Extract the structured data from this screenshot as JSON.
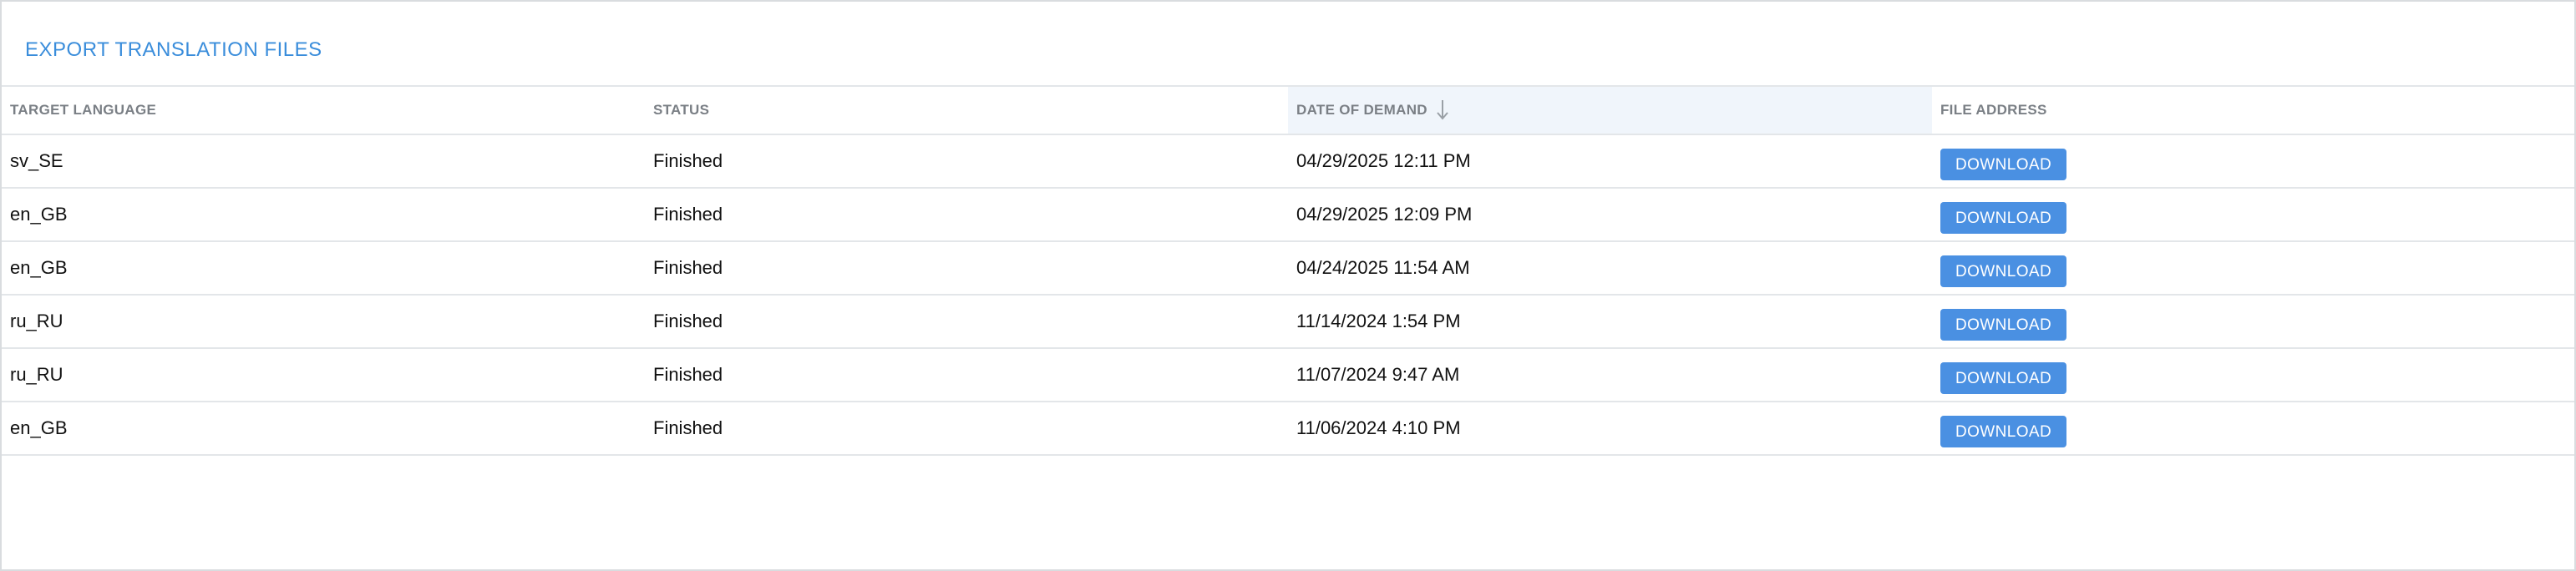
{
  "panel": {
    "title": "EXPORT TRANSLATION FILES"
  },
  "columns": [
    {
      "label": "TARGET LANGUAGE"
    },
    {
      "label": "STATUS"
    },
    {
      "label": "DATE OF DEMAND",
      "sort": "descending"
    },
    {
      "label": "FILE ADDRESS"
    }
  ],
  "rows": [
    {
      "language": "sv_SE",
      "status": "Finished",
      "date": "04/29/2025 12:11 PM",
      "action": "DOWNLOAD"
    },
    {
      "language": "en_GB",
      "status": "Finished",
      "date": "04/29/2025 12:09 PM",
      "action": "DOWNLOAD"
    },
    {
      "language": "en_GB",
      "status": "Finished",
      "date": "04/24/2025 11:54 AM",
      "action": "DOWNLOAD"
    },
    {
      "language": "ru_RU",
      "status": "Finished",
      "date": "11/14/2024 1:54 PM",
      "action": "DOWNLOAD"
    },
    {
      "language": "ru_RU",
      "status": "Finished",
      "date": "11/07/2024 9:47 AM",
      "action": "DOWNLOAD"
    },
    {
      "language": "en_GB",
      "status": "Finished",
      "date": "11/06/2024 4:10 PM",
      "action": "DOWNLOAD"
    }
  ],
  "colors": {
    "accent": "#4a90e2",
    "title": "#3a8ddb",
    "sorted_header_bg": "#f0f5fb"
  },
  "icons": {
    "sort": "arrow-down-icon"
  }
}
